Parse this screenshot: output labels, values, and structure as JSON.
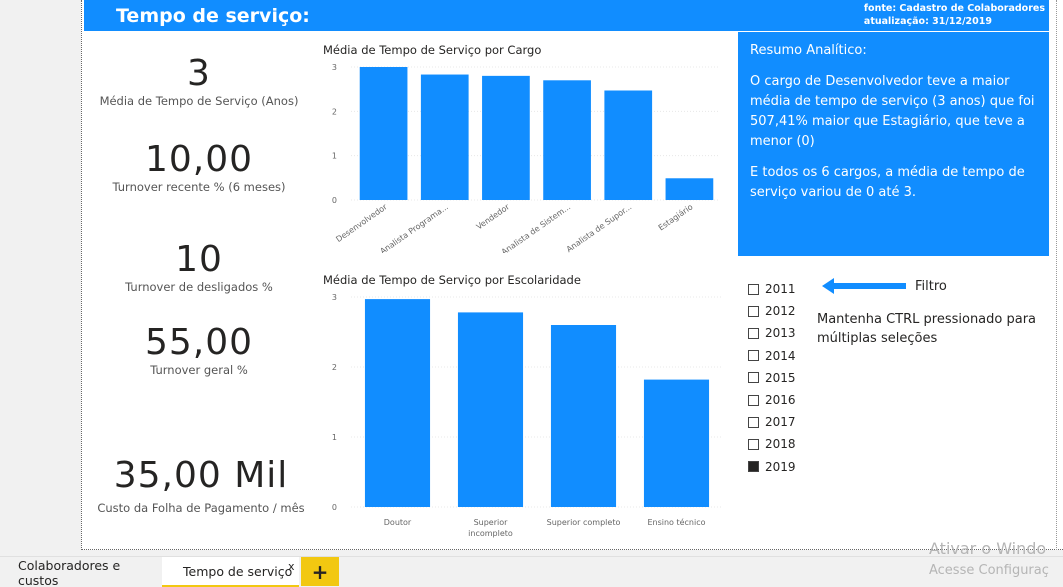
{
  "header": {
    "title": "Tempo de serviço:",
    "source_line1": "fonte: Cadastro de Colaboradores",
    "source_line2": "atualização: 31/12/2019"
  },
  "kpis": [
    {
      "value": "3",
      "label": "Média de Tempo de Serviço (Anos)"
    },
    {
      "value": "10,00",
      "label": "Turnover recente % (6 meses)"
    },
    {
      "value": "10",
      "label": "Turnover de desligados %"
    },
    {
      "value": "55,00",
      "label": "Turnover geral %"
    },
    {
      "value": "35,00 Mil",
      "label": "Custo da Folha de Pagamento / mês"
    }
  ],
  "chart_data": [
    {
      "type": "bar",
      "title": "Média de Tempo de Serviço por Cargo",
      "categories": [
        "Desenvolvedor",
        "Analista Programa...",
        "Vendedor",
        "Analista de Sistem...",
        "Analista de Supor...",
        "Estagiário"
      ],
      "values": [
        3.0,
        2.83,
        2.8,
        2.7,
        2.47,
        0.49
      ],
      "yticks": [
        "0",
        "1",
        "2",
        "3"
      ],
      "ylim": [
        0,
        3
      ],
      "color": "#118dff"
    },
    {
      "type": "bar",
      "title": "Média de Tempo de Serviço por Escolaridade",
      "categories": [
        "Doutor",
        "Superior incompleto",
        "Superior completo",
        "Ensino técnico"
      ],
      "values": [
        2.97,
        2.78,
        2.6,
        1.82
      ],
      "yticks": [
        "0",
        "1",
        "2",
        "3"
      ],
      "ylim": [
        0,
        3
      ],
      "color": "#118dff"
    }
  ],
  "summary": {
    "title": "Resumo Analítico:",
    "paragraph1": "O cargo de Desenvolvedor teve a maior média de tempo de serviço (3 anos)  que foi 507,41% maior que Estagiário, que teve a menor (0)",
    "paragraph2": "E todos os 6 cargos, a média de tempo de serviço variou de 0 até 3."
  },
  "slicer": {
    "items": [
      {
        "label": "2011",
        "checked": false
      },
      {
        "label": "2012",
        "checked": false
      },
      {
        "label": "2013",
        "checked": false
      },
      {
        "label": "2014",
        "checked": false
      },
      {
        "label": "2015",
        "checked": false
      },
      {
        "label": "2016",
        "checked": false
      },
      {
        "label": "2017",
        "checked": false
      },
      {
        "label": "2018",
        "checked": false
      },
      {
        "label": "2019",
        "checked": true
      }
    ]
  },
  "annotation": {
    "filter_label": "Filtro",
    "hint": "Mantenha CTRL pressionado para múltiplas seleções",
    "arrow_icon": "arrow-left-icon"
  },
  "tabs": {
    "items": [
      "Colaboradores e custos",
      "Tempo de serviço"
    ],
    "active": "Tempo de serviço",
    "close_label": "x",
    "add_label": "+"
  },
  "watermark": {
    "line1": "Ativar o Windo",
    "line2": "Acesse Configuraç"
  },
  "colors": {
    "accent": "#118dff",
    "tab_accent": "#f2c811"
  }
}
